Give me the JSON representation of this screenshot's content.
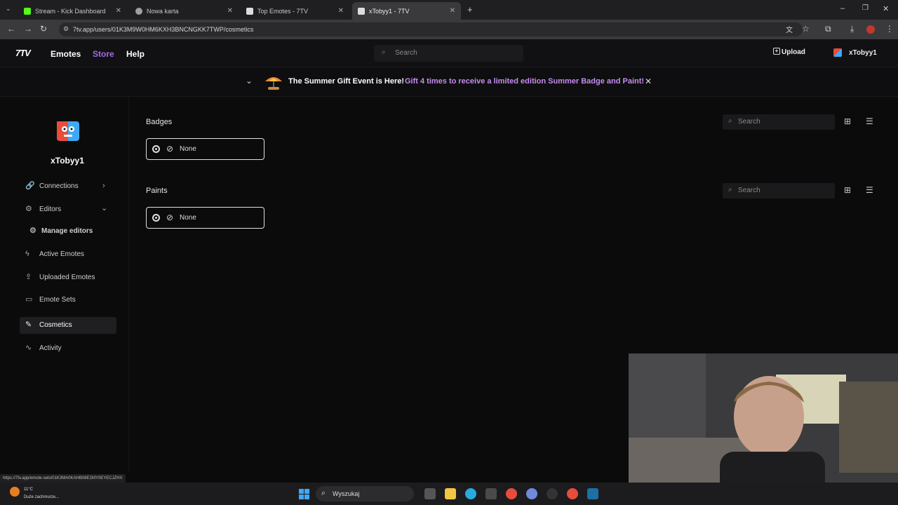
{
  "browser": {
    "tabs": [
      {
        "title": "Stream - Kick Dashboard",
        "active": false,
        "favicon_color": "#53fc18"
      },
      {
        "title": "Nowa karta",
        "active": false,
        "favicon_color": "#9aa0a6"
      },
      {
        "title": "Top Emotes - 7TV",
        "active": false,
        "favicon_color": "#e0e0e0"
      },
      {
        "title": "xTobyy1 - 7TV",
        "active": true,
        "favicon_color": "#e0e0e0"
      }
    ],
    "url": "7tv.app/users/01K3M9W0HM6KXH3BNCNGKK7TWP/cosmetics",
    "status_url": "https://7tv.app/emote-sets/01K3MA0KAHB08E2MY0EYECJZHX"
  },
  "header": {
    "logo": "7TV",
    "nav": [
      "Emotes",
      "Store",
      "Help"
    ],
    "search_placeholder": "Search",
    "upload_label": "Upload",
    "username": "xTobyy1",
    "accent": "#a56be6"
  },
  "banner": {
    "title": "The Summer Gift Event is Here!",
    "message": "Gift 4 times to receive a limited edition Summer Badge and Paint!",
    "link_color": "#c58cf0"
  },
  "sidebar": {
    "username": "xTobyy1",
    "items": [
      {
        "label": "Connections",
        "icon": "link-icon"
      },
      {
        "label": "Editors",
        "icon": "gear-icon"
      },
      {
        "label": "Manage editors",
        "icon": "gear-icon"
      },
      {
        "label": "Active Emotes",
        "icon": "bolt-icon"
      },
      {
        "label": "Uploaded Emotes",
        "icon": "upload-icon"
      },
      {
        "label": "Emote Sets",
        "icon": "folder-icon"
      },
      {
        "label": "Cosmetics",
        "icon": "brush-icon"
      },
      {
        "label": "Activity",
        "icon": "activity-icon"
      }
    ]
  },
  "main": {
    "badges": {
      "title": "Badges",
      "option": "None",
      "search_placeholder": "Search"
    },
    "paints": {
      "title": "Paints",
      "option": "None",
      "search_placeholder": "Search"
    }
  },
  "taskbar": {
    "weather_temp": "11°C",
    "weather_desc": "Duże zachmurze...",
    "search_placeholder": "Wyszukaj"
  }
}
